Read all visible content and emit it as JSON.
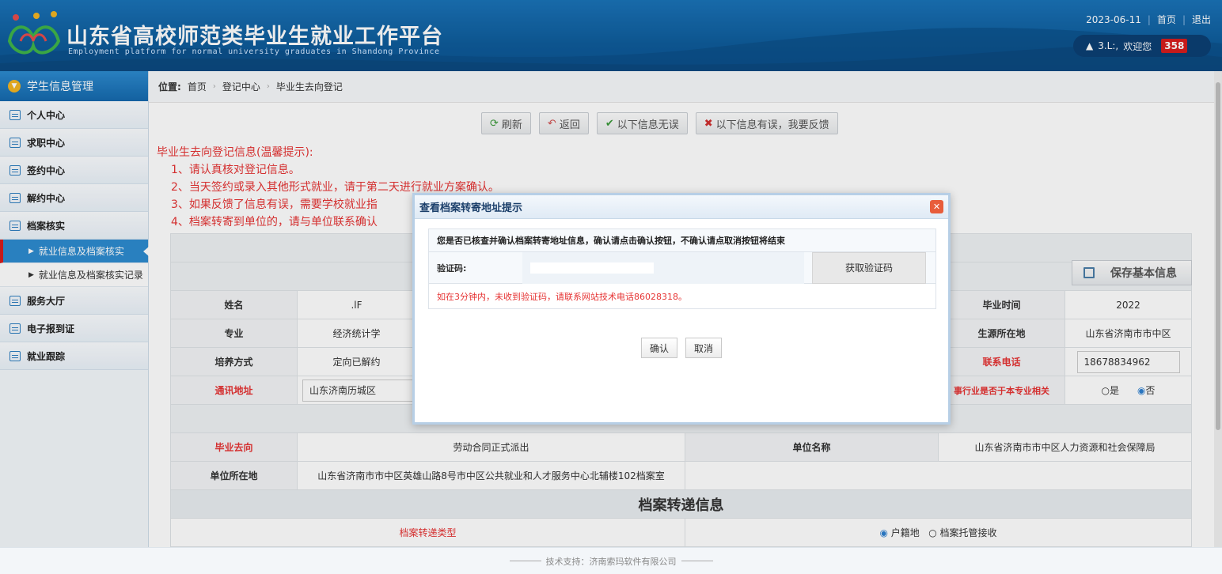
{
  "header": {
    "title": "山东省高校师范类毕业生就业工作平台",
    "subtitle": "Employment platform for normal university graduates in Shandong Province",
    "date": "2023-06-11",
    "home_link": "首页",
    "logout_link": "退出",
    "welcome": "欢迎您",
    "user_name": "3.L:,",
    "badge_count": "358",
    "colors": {
      "header_bg": "#1a73b8",
      "badge": "#d71d1d"
    }
  },
  "sidebar": {
    "head_label": "学生信息管理",
    "items": [
      {
        "label": "个人中心"
      },
      {
        "label": "求职中心"
      },
      {
        "label": "签约中心"
      },
      {
        "label": "解约中心"
      },
      {
        "label": "档案核实"
      }
    ],
    "sub_items": [
      {
        "label": "就业信息及档案核实",
        "active": true
      },
      {
        "label": "就业信息及档案核实记录",
        "active": false
      }
    ],
    "items_after": [
      {
        "label": "服务大厅"
      },
      {
        "label": "电子报到证"
      },
      {
        "label": "就业跟踪"
      }
    ]
  },
  "breadcrumb": {
    "prefix": "位置:",
    "parts": [
      "首页",
      "登记中心",
      "毕业生去向登记"
    ]
  },
  "toolbar": {
    "refresh": "刷新",
    "back": "返回",
    "confirm": "以下信息无误",
    "feedback": "以下信息有误，我要反馈"
  },
  "tips": {
    "title": "毕业生去向登记信息(温馨提示):",
    "lines": [
      "1、请认真核对登记信息。",
      "2、当天签约或录入其他形式就业，请于第二天进行就业方案确认。",
      "3、如果反馈了信息有误，需要学校就业指",
      "4、档案转寄到单位的，请与单位联系确认"
    ]
  },
  "save_button": "保存基本信息",
  "table": {
    "name_label": "姓名",
    "name_value": ".lF",
    "grad_time_label": "毕业时间",
    "grad_time_value": "2022",
    "major_label": "专业",
    "major_value": "经济统计学",
    "origin_label": "生源所在地",
    "origin_value": "山东省济南市市中区",
    "training_label": "培养方式",
    "training_value": "定向已解约",
    "phone_label": "联系电话",
    "phone_value": "18678834962",
    "address_label": "通讯地址",
    "address_value": "山东济南历城区",
    "related_label": "事行业是否于本专业相关",
    "related_yes": "是",
    "related_no": "否",
    "dest_label": "毕业去向",
    "dest_value": "劳动合同正式派出",
    "unit_label": "单位名称",
    "unit_value": "山东省济南市市中区人力资源和社会保障局",
    "unit_addr_label": "单位所在地",
    "unit_addr_value": "山东省济南市市中区英雄山路8号市中区公共就业和人才服务中心北辅楼102档案室",
    "archive_section": "档案转递信息",
    "archive_type_label": "档案转递类型",
    "archive_opt1": "户籍地",
    "archive_opt2": "档案托管接收"
  },
  "modal": {
    "title": "查看档案转寄地址提示",
    "message": "您是否已核查并确认档案转寄地址信息，确认请点击确认按钮，不确认请点取消按钮将结束",
    "code_label": "验证码:",
    "get_code": "获取验证码",
    "note": "如在3分钟内，未收到验证码，请联系网站技术电话86028318。",
    "ok": "确认",
    "cancel": "取消"
  },
  "footer": {
    "text": "技术支持：济南索玛软件有限公司"
  }
}
